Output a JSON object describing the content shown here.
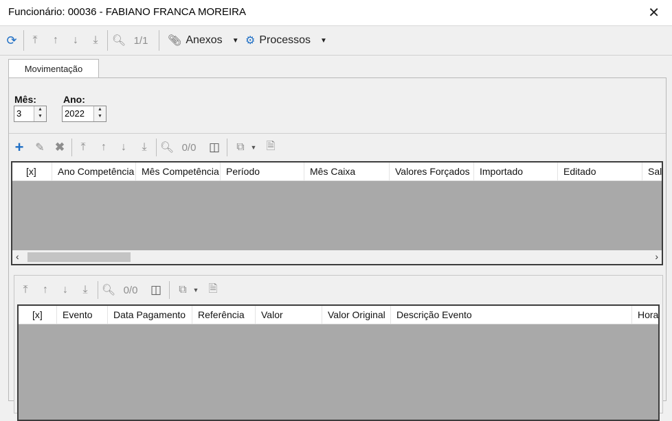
{
  "window": {
    "title": "Funcionário: 00036 - FABIANO FRANCA MOREIRA"
  },
  "toolbar": {
    "counter": "1/1",
    "anexos_label": "Anexos",
    "processos_label": "Processos"
  },
  "tabs": [
    {
      "label": "Movimentação"
    }
  ],
  "filters": {
    "mes_label": "Mês:",
    "mes_value": "3",
    "ano_label": "Ano:",
    "ano_value": "2022"
  },
  "grid1": {
    "counter": "0/0",
    "columns": [
      "[x]",
      "Ano Competência",
      "Mês Competência",
      "Período",
      "Mês Caixa",
      "Valores Forçados",
      "Importado",
      "Editado",
      "Sala"
    ]
  },
  "grid2": {
    "counter": "0/0",
    "columns": [
      "[x]",
      "Evento",
      "Data Pagamento",
      "Referência",
      "Valor",
      "Valor Original",
      "Descrição Evento",
      "Hora"
    ]
  },
  "icons": {
    "refresh": "refresh-icon",
    "first": "first-record-icon",
    "prev": "previous-record-icon",
    "next": "next-record-icon",
    "last": "last-record-icon",
    "search": "search-icon",
    "attach": "paperclip-icon",
    "gear": "gear-icon",
    "add": "add-icon",
    "edit": "edit-icon",
    "delete": "delete-icon",
    "columns": "columns-icon",
    "export": "export-icon",
    "report": "report-icon"
  },
  "colors": {
    "accent": "#1f6fc5",
    "grid_body": "#a9a9a9"
  }
}
